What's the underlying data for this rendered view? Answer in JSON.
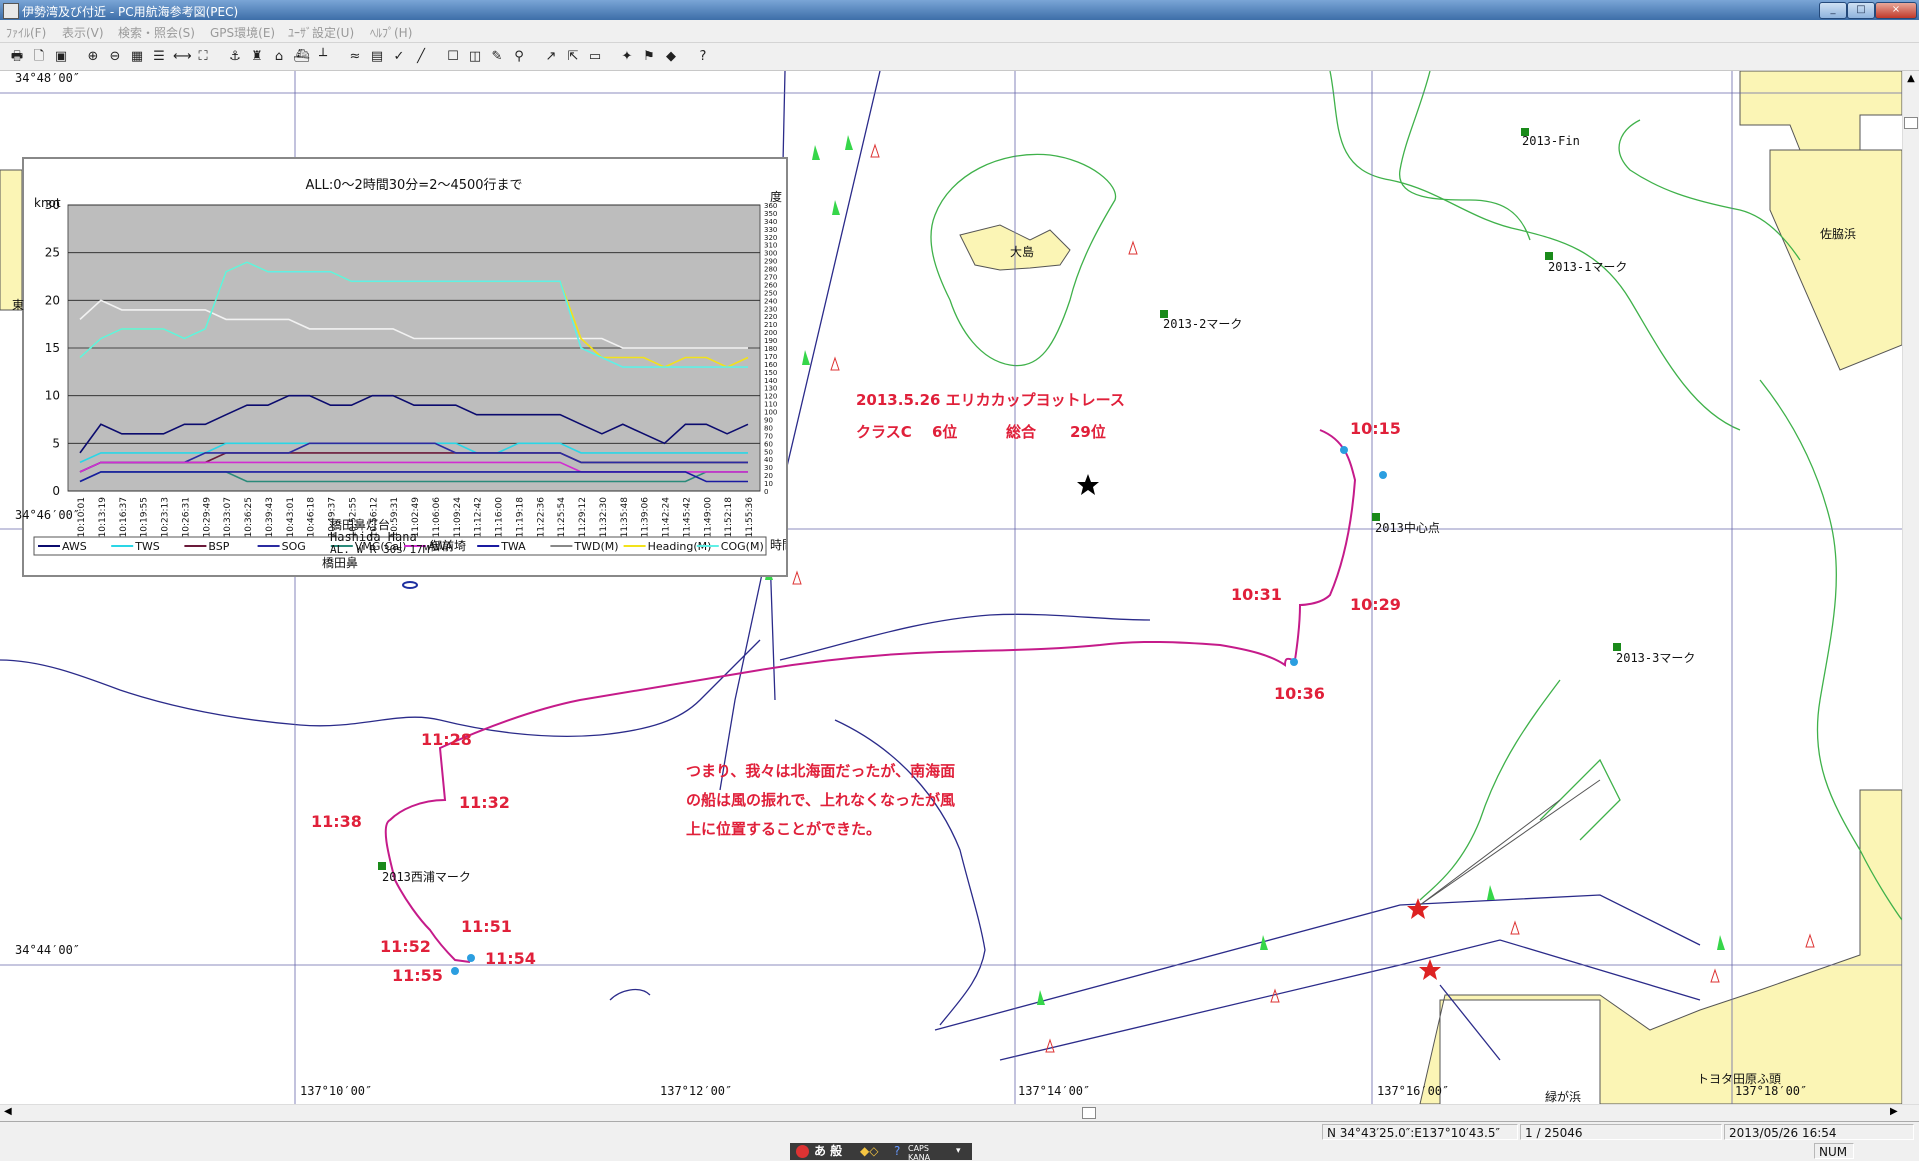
{
  "window": {
    "title": "伊勢湾及び付近 - PC用航海参考図(PEC)",
    "buttons": [
      "_",
      "□",
      "×"
    ]
  },
  "menu": [
    "ﾌｧｲﾙ(F)",
    "表示(V)",
    "検索・照会(S)",
    "GPS環境(E)",
    "ﾕｰｻﾞ設定(U)",
    "ﾍﾙﾌﾟ(H)"
  ],
  "toolbar": {
    "icons": [
      "print-icon",
      "print-preview-icon",
      "chart-icon",
      "zoom-in-icon",
      "zoom-out-icon",
      "grid-icon",
      "layer-icon",
      "ruler-icon",
      "route-icon",
      "anchor-icon",
      "buoy-icon",
      "harbor-icon",
      "ship-icon",
      "pier-icon",
      "tide-icon",
      "table-icon",
      "waypoint-icon",
      "line-icon",
      "comment-icon",
      "area-icon",
      "pencil-icon",
      "search-icon",
      "track-icon",
      "cursor-icon",
      "window-icon",
      "tool-icon",
      "flag-icon",
      "marker-icon",
      "help-icon"
    ],
    "glyphs": [
      "🖶",
      "🗋",
      "▣",
      "⊕",
      "⊖",
      "▦",
      "☰",
      "⟷",
      "⛶",
      "⚓",
      "♜",
      "⌂",
      "⛴",
      "┴",
      "≈",
      "▤",
      "✓",
      "╱",
      "☐",
      "◫",
      "✎",
      "⚲",
      "↗",
      "⇱",
      "▭",
      "✦",
      "⚑",
      "◆",
      "?"
    ]
  },
  "map": {
    "lat_labels": [
      "34°48′00″",
      "34°46′00″",
      "34°44′00″"
    ],
    "lon_labels": [
      "137°10′00″",
      "137°12′00″",
      "137°14′00″",
      "137°16′00″",
      "137°18′00″"
    ],
    "places": {
      "oshima": "大島",
      "sawarahama": "佐脇浜",
      "lighthouse": "橋田鼻灯台",
      "lighthouse_en": "Hashida Hana",
      "lighthouse_light": "AL. W R 30s 17M",
      "cape": "御前埼",
      "hashidabana": "橋田鼻",
      "east": "東",
      "toyota_pier": "トヨタ田原ふ頭",
      "midorigahama": "緑が浜"
    },
    "marks": {
      "fin": "2013-Fin",
      "mark1": "2013-1マーク",
      "mark2": "2013-2マーク",
      "center": "2013中心点",
      "mark3": "2013-3マーク",
      "nishiura": "2013西浦マーク"
    },
    "race_title": "2013.5.26 エリカカップヨットレース",
    "race_result_class": "クラスC",
    "race_result_class_rank": "6位",
    "race_result_overall": "総合",
    "race_result_overall_rank": "29位",
    "times": [
      "10:15",
      "10:29",
      "10:31",
      "10:36",
      "11:28",
      "11:32",
      "11:38",
      "11:51",
      "11:52",
      "11:54",
      "11:55"
    ],
    "comment_lines": [
      "つまり、我々は北海面だったが、南海面",
      "の船は風の振れで、上れなくなったが風",
      "上に位置することができた。"
    ]
  },
  "chart_data": {
    "type": "line",
    "title": "ALL:0～2時間30分=2～4500行まで",
    "ylabel_left": "knot",
    "ylabel_right": "度",
    "xlabel": "時間",
    "ylim": [
      0,
      30
    ],
    "yticks_left": [
      0,
      5,
      10,
      15,
      20,
      25,
      30
    ],
    "yticks_right": [
      0,
      10,
      20,
      30,
      40,
      50,
      60,
      70,
      80,
      90,
      100,
      110,
      120,
      130,
      140,
      150,
      160,
      170,
      180,
      190,
      200,
      210,
      220,
      230,
      240,
      250,
      260,
      270,
      280,
      290,
      300,
      310,
      320,
      330,
      340,
      350,
      360
    ],
    "categories": [
      "10:10:01",
      "10:13:19",
      "10:16:37",
      "10:19:55",
      "10:23:13",
      "10:26:31",
      "10:29:49",
      "10:33:07",
      "10:36:25",
      "10:39:43",
      "10:43:01",
      "10:46:18",
      "10:49:37",
      "10:52:55",
      "10:56:12",
      "10:59:31",
      "11:02:49",
      "11:06:06",
      "11:09:24",
      "11:12:42",
      "11:16:00",
      "11:19:18",
      "11:22:36",
      "11:25:54",
      "11:29:12",
      "11:32:30",
      "11:35:48",
      "11:39:06",
      "11:42:24",
      "11:45:42",
      "11:49:00",
      "11:52:18",
      "11:55:36"
    ],
    "series": [
      {
        "name": "AWS",
        "color": "#0b0b6e",
        "values": [
          4,
          7,
          6,
          6,
          6,
          7,
          7,
          8,
          9,
          9,
          10,
          10,
          9,
          9,
          10,
          10,
          9,
          9,
          9,
          8,
          8,
          8,
          8,
          8,
          7,
          6,
          7,
          6,
          5,
          7,
          7,
          6,
          7
        ]
      },
      {
        "name": "TWS",
        "color": "#2ad6e6",
        "values": [
          3,
          4,
          4,
          4,
          4,
          4,
          4,
          5,
          5,
          5,
          5,
          5,
          5,
          5,
          5,
          5,
          5,
          5,
          5,
          4,
          4,
          5,
          5,
          5,
          4,
          4,
          4,
          4,
          4,
          4,
          4,
          4,
          4
        ]
      },
      {
        "name": "BSP",
        "color": "#6b1a3a",
        "values": [
          2,
          3,
          3,
          3,
          3,
          3,
          3,
          4,
          4,
          4,
          4,
          4,
          4,
          4,
          4,
          4,
          4,
          4,
          4,
          4,
          4,
          4,
          4,
          4,
          3,
          3,
          3,
          3,
          3,
          3,
          3,
          3,
          3
        ]
      },
      {
        "name": "SOG",
        "color": "#2b2ba0",
        "values": [
          2,
          3,
          3,
          3,
          3,
          3,
          4,
          4,
          4,
          4,
          4,
          5,
          5,
          5,
          5,
          5,
          5,
          5,
          4,
          4,
          4,
          4,
          4,
          4,
          3,
          3,
          3,
          3,
          3,
          3,
          3,
          3,
          3
        ]
      },
      {
        "name": "VMG(Cal)",
        "color": "#2a8a7a",
        "values": [
          1,
          2,
          2,
          2,
          2,
          2,
          2,
          2,
          1,
          1,
          1,
          1,
          1,
          1,
          1,
          1,
          1,
          1,
          1,
          1,
          1,
          1,
          1,
          1,
          1,
          1,
          1,
          1,
          1,
          1,
          2,
          2,
          2
        ]
      },
      {
        "name": "AWA",
        "color": "#d12ed1",
        "values": [
          2,
          3,
          3,
          3,
          3,
          3,
          3,
          3,
          3,
          3,
          3,
          3,
          3,
          3,
          3,
          3,
          3,
          3,
          3,
          3,
          3,
          3,
          3,
          3,
          2,
          2,
          2,
          2,
          2,
          2,
          2,
          2,
          2
        ]
      },
      {
        "name": "TWA",
        "color": "#1a1aa0",
        "values": [
          1,
          2,
          2,
          2,
          2,
          2,
          2,
          2,
          2,
          2,
          2,
          2,
          2,
          2,
          2,
          2,
          2,
          2,
          2,
          2,
          2,
          2,
          2,
          2,
          2,
          2,
          2,
          2,
          2,
          2,
          1,
          1,
          1
        ]
      },
      {
        "name": "TWD(M)",
        "color": "#f2f2f2",
        "values": [
          18,
          20,
          19,
          19,
          19,
          19,
          19,
          18,
          18,
          18,
          18,
          17,
          17,
          17,
          17,
          17,
          16,
          16,
          16,
          16,
          16,
          16,
          16,
          16,
          16,
          16,
          15,
          15,
          15,
          15,
          15,
          15,
          15
        ]
      },
      {
        "name": "Heading(M)",
        "color": "#f2e21a",
        "values": [
          14,
          16,
          17,
          17,
          17,
          16,
          17,
          23,
          24,
          23,
          23,
          23,
          23,
          22,
          22,
          22,
          22,
          22,
          22,
          22,
          22,
          22,
          22,
          22,
          16,
          14,
          14,
          14,
          13,
          14,
          14,
          13,
          14
        ]
      },
      {
        "name": "COG(M)",
        "color": "#5ff0e6",
        "values": [
          14,
          16,
          17,
          17,
          17,
          16,
          17,
          23,
          24,
          23,
          23,
          23,
          23,
          22,
          22,
          22,
          22,
          22,
          22,
          22,
          22,
          22,
          22,
          22,
          15,
          14,
          13,
          13,
          13,
          13,
          13,
          13,
          13
        ]
      }
    ],
    "grid": true,
    "legend_placement": "bottom"
  },
  "status": {
    "position": "N 34°43′25.0″:E137°10′43.5″",
    "scale": "1 / 25046",
    "datetime": "2013/05/26 16:54",
    "num": "NUM"
  },
  "ime": {
    "kana": "あ 般",
    "caps": "CAPS",
    "kana_label": "KANA"
  }
}
